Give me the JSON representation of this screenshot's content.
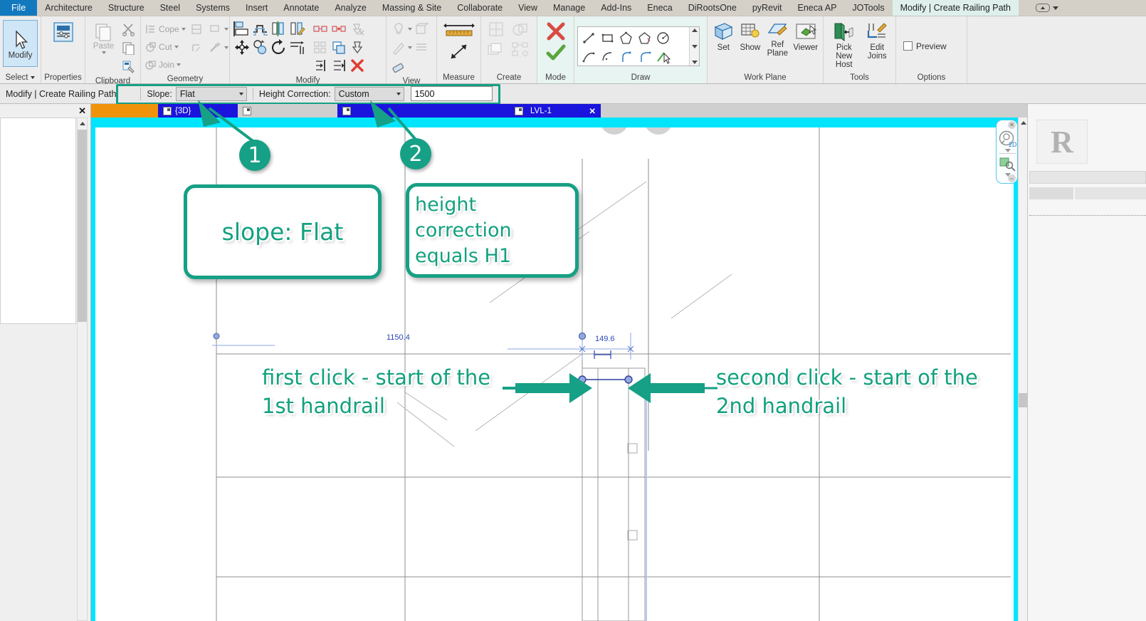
{
  "app": {
    "accent_teal": "#16a085",
    "ribbon_tab_bg": "#d4d0c8",
    "context_tab_bg": "#dff0ec",
    "canvas_crop_cyan": "#00e5ff",
    "view_tab_blue": "#1a14dc",
    "view_tab_orange": "#f0930b"
  },
  "ribbon_tabs": [
    {
      "label": "File",
      "kind": "file"
    },
    {
      "label": "Architecture",
      "kind": "normal"
    },
    {
      "label": "Structure",
      "kind": "normal"
    },
    {
      "label": "Steel",
      "kind": "normal"
    },
    {
      "label": "Systems",
      "kind": "normal"
    },
    {
      "label": "Insert",
      "kind": "normal"
    },
    {
      "label": "Annotate",
      "kind": "normal"
    },
    {
      "label": "Analyze",
      "kind": "normal"
    },
    {
      "label": "Massing & Site",
      "kind": "normal"
    },
    {
      "label": "Collaborate",
      "kind": "normal"
    },
    {
      "label": "View",
      "kind": "normal"
    },
    {
      "label": "Manage",
      "kind": "normal"
    },
    {
      "label": "Add-Ins",
      "kind": "normal"
    },
    {
      "label": "Eneca",
      "kind": "normal"
    },
    {
      "label": "DiRootsOne",
      "kind": "normal"
    },
    {
      "label": "pyRevit",
      "kind": "normal"
    },
    {
      "label": "Eneca AP",
      "kind": "normal"
    },
    {
      "label": "JOTools",
      "kind": "normal"
    },
    {
      "label": "Modify | Create Railing Path",
      "kind": "context"
    }
  ],
  "ribbon_panels": {
    "select": {
      "title": "Select",
      "modify_label": "Modify"
    },
    "properties": {
      "title": "Properties",
      "label": "Properties"
    },
    "clipboard": {
      "title": "Clipboard",
      "paste_label": "Paste"
    },
    "geometry": {
      "title": "Geometry",
      "cope_label": "Cope",
      "cut_label": "Cut",
      "join_label": "Join"
    },
    "modify": {
      "title": "Modify"
    },
    "view": {
      "title": "View"
    },
    "measure": {
      "title": "Measure"
    },
    "create": {
      "title": "Create"
    },
    "mode": {
      "title": "Mode"
    },
    "draw": {
      "title": "Draw"
    },
    "workplane": {
      "title": "Work Plane",
      "set_label": "Set",
      "show_label": "Show",
      "ref_plane_label": "Ref\nPlane",
      "viewer_label": "Viewer"
    },
    "tools": {
      "title": "Tools",
      "pick_new_host_label": "Pick\nNew Host",
      "edit_joins_label": "Edit\nJoins"
    },
    "options": {
      "title": "Options",
      "preview_label": "Preview"
    }
  },
  "options_bar": {
    "context_label": "Modify | Create Railing Path",
    "slope_label": "Slope:",
    "slope_value": "Flat",
    "height_correction_label": "Height Correction:",
    "height_correction_value": "Custom",
    "height_value": "1500"
  },
  "view_tabs": [
    {
      "label": "",
      "kind": "orange",
      "icon": "view-icon"
    },
    {
      "label": "{3D}",
      "kind": "blue",
      "icon": "cube-icon"
    },
    {
      "label": "",
      "kind": "grey",
      "icon": "cube-icon"
    },
    {
      "label": "",
      "kind": "blue",
      "icon": "sheet-icon"
    },
    {
      "label": "LVL-1",
      "kind": "blue",
      "icon": "plan-icon",
      "close": "✕"
    }
  ],
  "view_tab_close": "✕",
  "canvas": {
    "dimension_left": "1150.4",
    "dimension_right": "149.6"
  },
  "annotations": {
    "badge1": "1",
    "badge2": "2",
    "callout1": "slope: Flat",
    "callout2": "height correction\nequals H1",
    "note_left": "first click - start of the\n1st handrail",
    "note_right": "second click - start of the\n2nd handrail"
  },
  "right_panel": {
    "logo_letter": "R"
  }
}
